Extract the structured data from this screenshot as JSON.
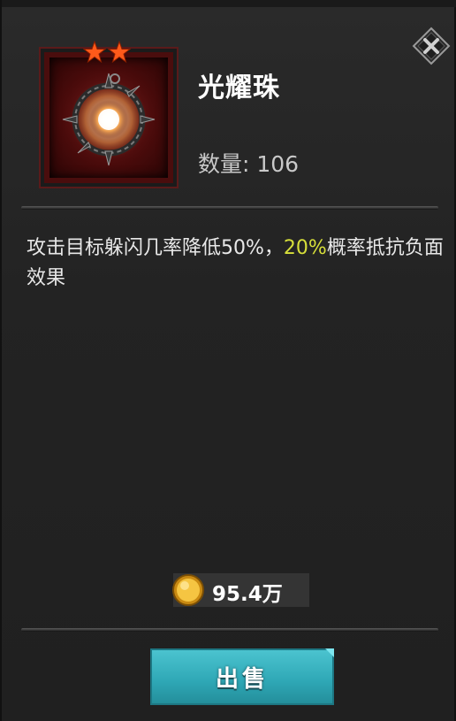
{
  "item": {
    "name": "光耀珠",
    "quantity_label": "数量: 106",
    "star_count": 2,
    "description_before": "攻击目标躲闪几率降低50%，",
    "description_highlight": "20%",
    "description_after": "概率抵抗负面效果"
  },
  "price": {
    "value": "95.4万",
    "currency_icon": "gold-coin-icon"
  },
  "actions": {
    "sell_label": "出售",
    "close_icon": "close-icon"
  },
  "colors": {
    "highlight": "#d7df3a",
    "sell_button": "#2ea7b5",
    "frame_red": "#4a0d0d",
    "star": "#ff5a1a"
  }
}
